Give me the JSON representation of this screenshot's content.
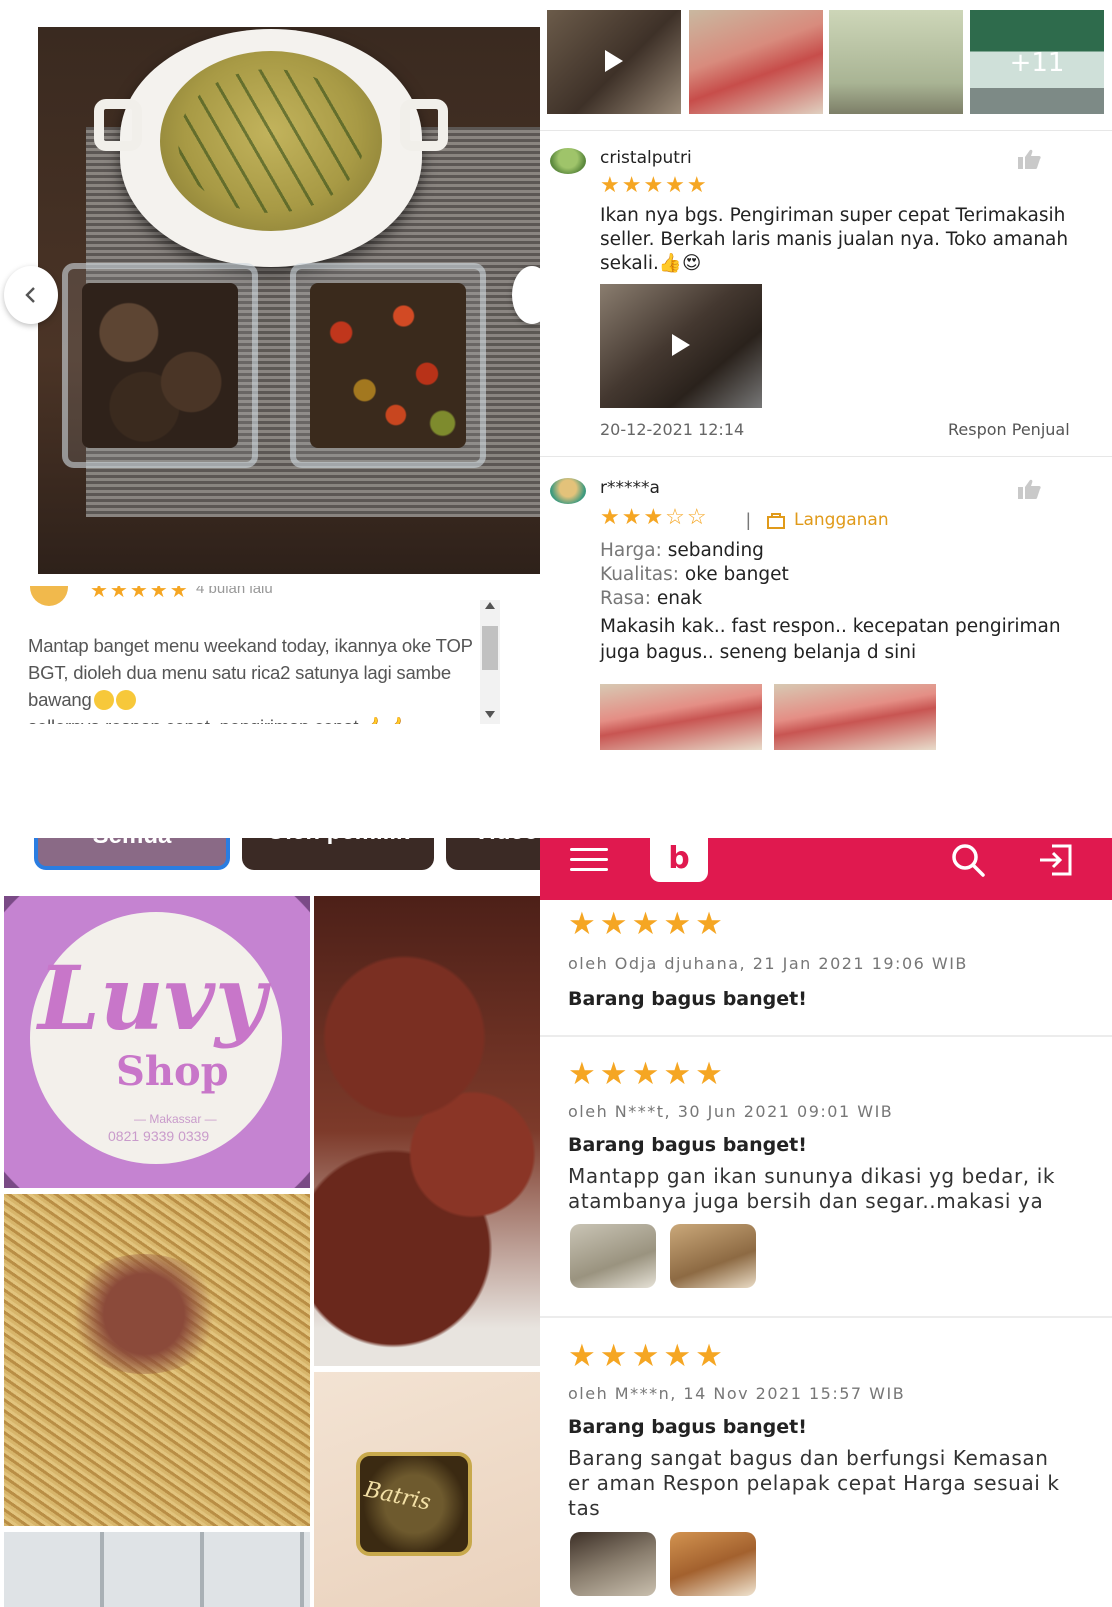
{
  "top_left": {
    "review": {
      "stars": "★★★★★",
      "time": "4 bulan lalu",
      "text_line1": "Mantap banget menu weekand today, ikannya oke TOP",
      "text_line2": "BGT, dioleh dua menu satu rica2 satunya lagi sambe",
      "text_line3": "bawang",
      "text_line4": "sellernya respon cepat, pengiriman cepat 👍👍"
    }
  },
  "top_right": {
    "thumbnails": {
      "more_count": "+11"
    },
    "reviews": [
      {
        "user": "cristalputri",
        "stars": "★★★★★",
        "text": "Ikan nya bgs. Pengiriman super cepat  Terimakasih seller. Berkah laris manis jualan nya. Toko amanah sekali.👍😍",
        "date": "20-12-2021 12:14",
        "response": "Respon Penjual"
      },
      {
        "user": "r*****a",
        "stars": "★★★☆☆",
        "separator": "|",
        "badge": "Langganan",
        "ratings": [
          {
            "key": "Harga:",
            "value": "sebanding"
          },
          {
            "key": "Kualitas:",
            "value": "oke banget"
          },
          {
            "key": "Rasa:",
            "value": "enak"
          }
        ],
        "text": "Makasih kak.. fast respon.. kecepatan pengiriman juga bagus.. seneng belanja d sini"
      }
    ]
  },
  "bottom_left": {
    "tabs": [
      "Semua",
      "Oleh pemilik",
      "Video"
    ],
    "logo": {
      "script": "Luvy",
      "shop": "Shop",
      "city": "— Makassar —",
      "phone": "0821 9339 0339"
    },
    "product_label": "Batris"
  },
  "bottom_right": {
    "logo_glyph": "b",
    "reviews": [
      {
        "stars": "★★★★★",
        "by": "oleh Odja djuhana, 21 Jan 2021 19:06 WIB",
        "title": "Barang bagus banget!"
      },
      {
        "stars": "★★★★★",
        "by": "oleh N***t, 30 Jun 2021 09:01 WIB",
        "title": "Barang bagus banget!",
        "body_line1": "Mantapp gan ikan sununya dikasi yg bedar, ik",
        "body_line2": "atambanya juga bersih dan segar..makasi ya"
      },
      {
        "stars": "★★★★★",
        "by": "oleh M***n, 14 Nov 2021 15:57 WIB",
        "title": "Barang bagus banget!",
        "body_line1": "Barang sangat bagus dan berfungsi Kemasan",
        "body_line2": "er aman Respon pelapak cepat Harga sesuai k",
        "body_line3": "tas"
      }
    ]
  }
}
